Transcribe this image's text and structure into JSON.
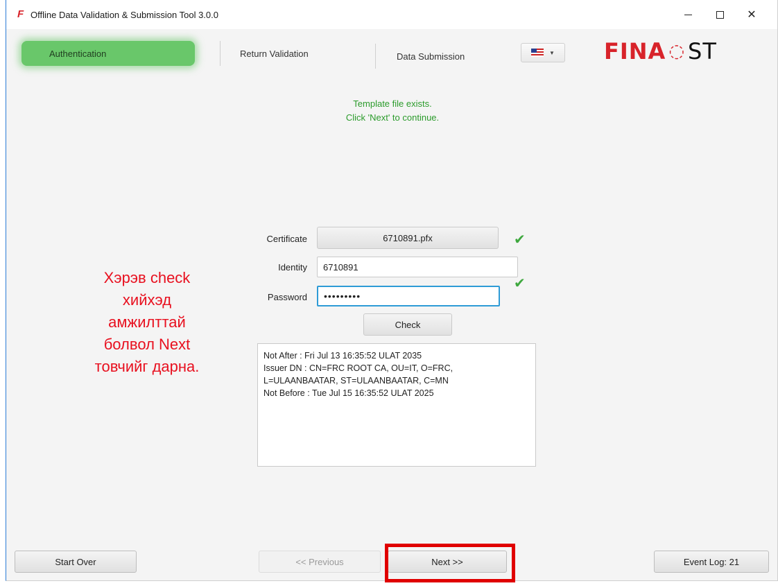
{
  "window": {
    "title": "Offline Data Validation & Submission Tool 3.0.0",
    "app_icon": "F"
  },
  "nav": {
    "tabs": [
      {
        "label": "Authentication",
        "active": true
      },
      {
        "label": "Return Validation",
        "active": false
      },
      {
        "label": "Data Submission",
        "active": false
      }
    ],
    "language": "flag-us-icon"
  },
  "logo": {
    "part1": "FINA",
    "part2": "ST"
  },
  "status": {
    "line1": "Template file exists.",
    "line2": "Click 'Next' to continue."
  },
  "form": {
    "certificate_label": "Certificate",
    "certificate_value": "6710891.pfx",
    "identity_label": "Identity",
    "identity_value": "6710891",
    "password_label": "Password",
    "password_value": "•••••••••",
    "check_label": "Check"
  },
  "cert_info": [
    "Not After : Fri Jul 13 16:35:52 ULAT 2035",
    "Issuer DN : CN=FRC ROOT CA, OU=IT, O=FRC,",
    "L=ULAANBAATAR, ST=ULAANBAATAR, C=MN",
    "Not Before : Tue Jul 15 16:35:52 ULAT 2025"
  ],
  "annotation": {
    "lines": [
      "Хэрэв check",
      "хийхэд",
      "амжилттай",
      "болвол Next",
      "товчийг дарна."
    ],
    "color": "#e8101f"
  },
  "footer": {
    "start_over": "Start Over",
    "previous": "<< Previous",
    "next": "Next >>",
    "event_log": "Event Log: 21"
  },
  "colors": {
    "accent_green": "#69c76a",
    "status_green": "#2b9b2b",
    "brand_red": "#d8232a",
    "highlight_red": "#e00000"
  }
}
